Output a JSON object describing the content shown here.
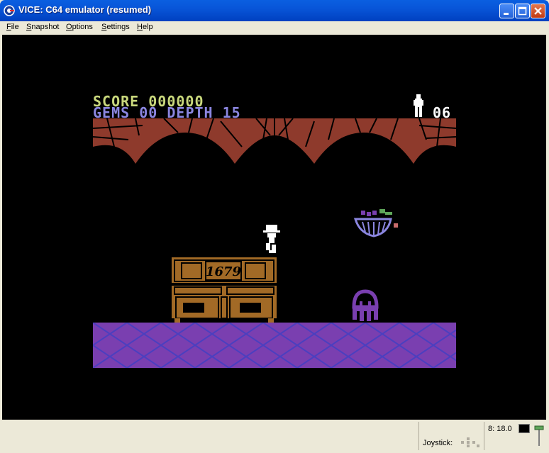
{
  "window": {
    "title": "VICE: C64 emulator (resumed)"
  },
  "menu": [
    "File",
    "Snapshot",
    "Options",
    "Settings",
    "Help"
  ],
  "game": {
    "score_label": "SCORE",
    "score_value": "000000",
    "gems_label": "GEMS",
    "gems_value": "00",
    "depth_label": "DEPTH",
    "depth_value": "15",
    "lives_value": "06",
    "sign_text": "1679"
  },
  "status": {
    "joystick_label": "Joystick:",
    "drive_text": "8: 18.0"
  },
  "colors": {
    "title_bar": "#0855d8",
    "score_yellow": "#c9d87c",
    "gems_purple": "#8b86e0",
    "ceiling_brick": "#8e3a2c",
    "floor_purple": "#7a3fb0",
    "cabinet_brown": "#a26a26"
  }
}
